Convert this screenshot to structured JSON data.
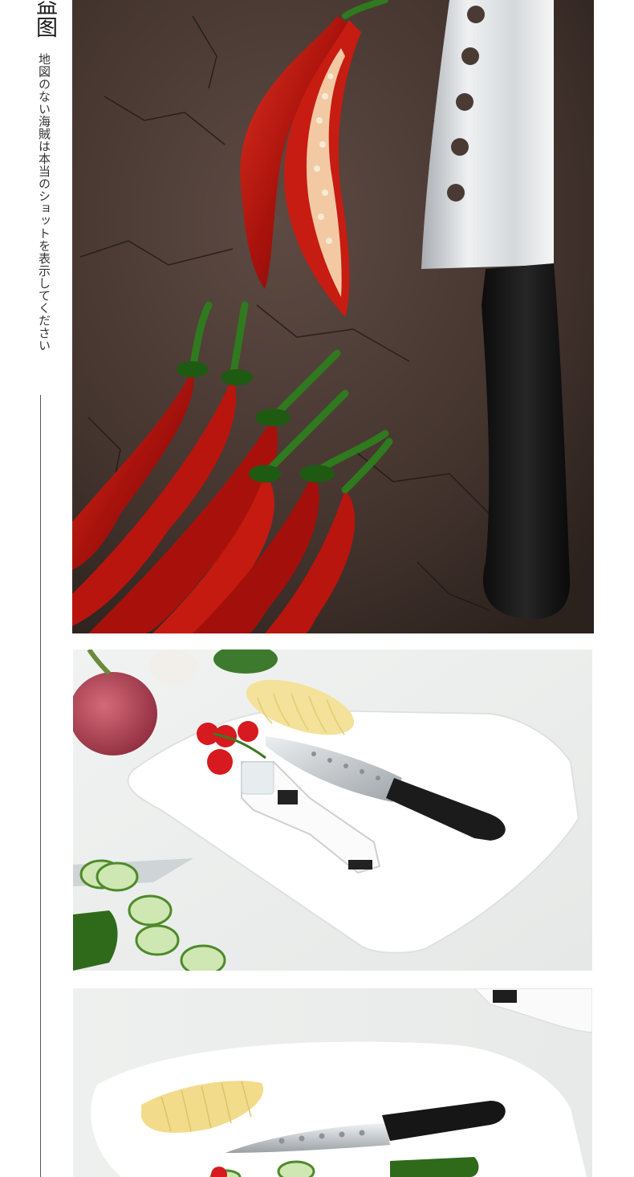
{
  "sidebar": {
    "title": "益图",
    "subtitle": "地図のない海賊は本当のショットを表示してください"
  },
  "photos": [
    {
      "subject": "red chili peppers and chef knife on dark stone surface"
    },
    {
      "subject": "knife sharpener, santoku knife, cherry tomatoes, potato slices and cucumber on white cutting board"
    },
    {
      "subject": "santoku knife, potato slices and cucumber on white cutting board"
    }
  ],
  "colors": {
    "background": "#ffffff",
    "stone": "#4a3a34",
    "chili": "#b3140e",
    "stem": "#2f7a1e",
    "handle": "#161616",
    "blade": "#d9dcdf",
    "board": "#f7f7f7",
    "cucumber": "#6fa13a"
  }
}
